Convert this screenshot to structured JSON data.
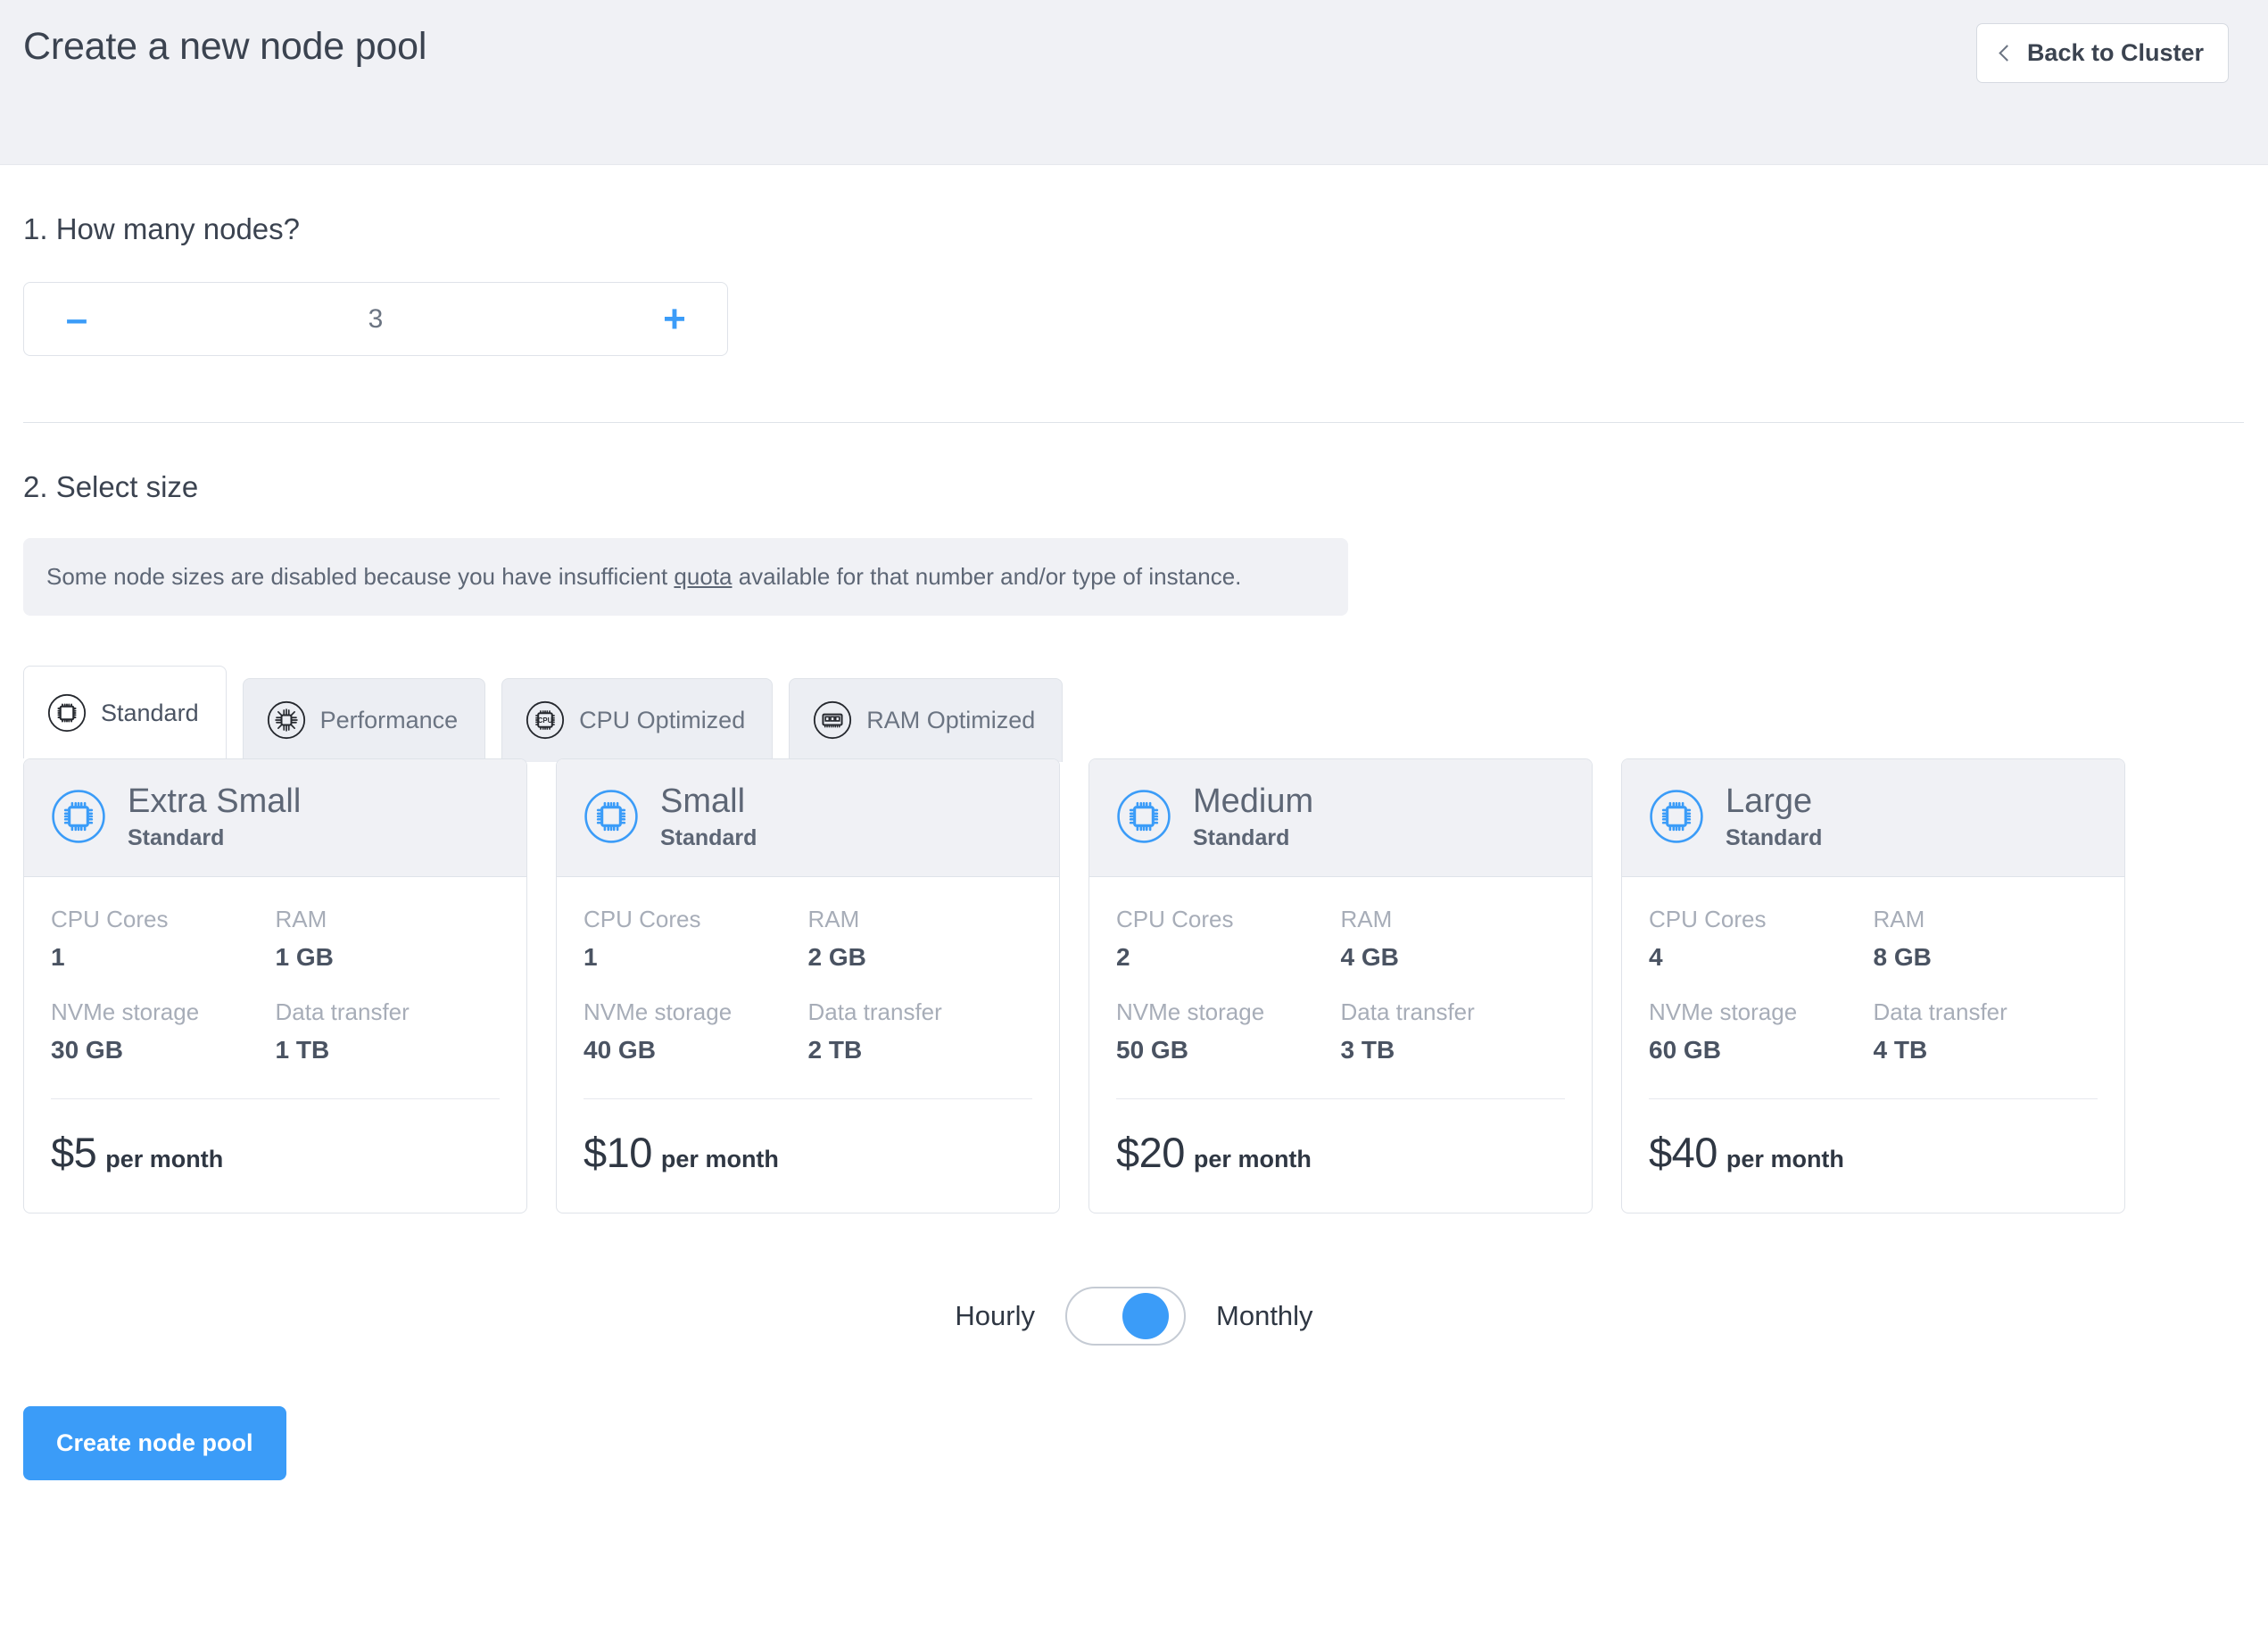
{
  "header": {
    "title": "Create a new node pool",
    "back_button_label": "Back to Cluster",
    "back_icon": "chevron-left-icon"
  },
  "steps": {
    "node_count": {
      "title": "1. How many nodes?",
      "decrement_label": "–",
      "increment_label": "+",
      "value": "3"
    },
    "select_size": {
      "title": "2. Select size",
      "notice_before": "Some node sizes are disabled because you have insufficient ",
      "notice_link": "quota",
      "notice_after": " available for that number and/or type of instance."
    }
  },
  "tabs": [
    {
      "label": "Standard",
      "icon": "chip-icon",
      "active": true
    },
    {
      "label": "Performance",
      "icon": "chip-burst-icon",
      "active": false
    },
    {
      "label": "CPU Optimized",
      "icon": "cpu-chip-icon",
      "active": false
    },
    {
      "label": "RAM Optimized",
      "icon": "memory-module-icon",
      "active": false
    }
  ],
  "spec_labels": {
    "cpu": "CPU Cores",
    "ram": "RAM",
    "storage": "NVMe storage",
    "transfer": "Data transfer"
  },
  "cards": [
    {
      "name": "Extra Small",
      "subtitle": "Standard",
      "icon": "chip-icon",
      "cpu": "1",
      "ram": "1 GB",
      "storage": "30 GB",
      "transfer": "1 TB",
      "price": "$5",
      "price_period": "per month"
    },
    {
      "name": "Small",
      "subtitle": "Standard",
      "icon": "chip-icon",
      "cpu": "1",
      "ram": "2 GB",
      "storage": "40 GB",
      "transfer": "2 TB",
      "price": "$10",
      "price_period": "per month"
    },
    {
      "name": "Medium",
      "subtitle": "Standard",
      "icon": "chip-icon",
      "cpu": "2",
      "ram": "4 GB",
      "storage": "50 GB",
      "transfer": "3 TB",
      "price": "$20",
      "price_period": "per month"
    },
    {
      "name": "Large",
      "subtitle": "Standard",
      "icon": "chip-icon",
      "cpu": "4",
      "ram": "8 GB",
      "storage": "60 GB",
      "transfer": "4 TB",
      "price": "$40",
      "price_period": "per month"
    }
  ],
  "billing": {
    "left_label": "Hourly",
    "right_label": "Monthly",
    "selected": "Monthly"
  },
  "submit": {
    "label": "Create node pool"
  },
  "colors": {
    "accent": "#3b9cf8",
    "header_bg": "#f0f1f5",
    "text": "#3b4350",
    "muted": "#a7adb8",
    "border": "#dfe3e9"
  }
}
